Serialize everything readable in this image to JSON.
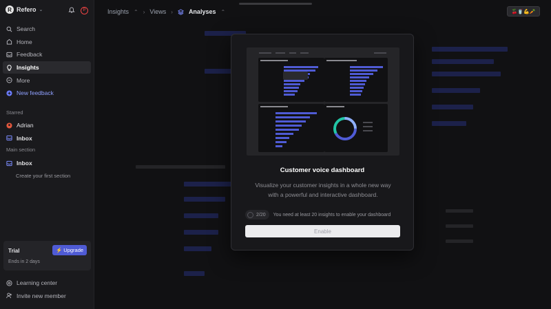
{
  "sidebar": {
    "workspace": {
      "logo": "R",
      "name": "Refero"
    },
    "nav": [
      {
        "label": "Search",
        "icon": "search-icon"
      },
      {
        "label": "Home",
        "icon": "home-icon"
      },
      {
        "label": "Feedback",
        "icon": "inbox-icon"
      },
      {
        "label": "Insights",
        "icon": "lightbulb-icon",
        "active": true
      },
      {
        "label": "More",
        "icon": "more-icon"
      },
      {
        "label": "New feedback",
        "icon": "plus-circle-icon"
      }
    ],
    "starred_label": "Starred",
    "starred": [
      {
        "label": "Adrian",
        "icon": "user-avatar-icon"
      },
      {
        "label": "Inbox",
        "icon": "inbox-icon"
      }
    ],
    "main_section_label": "Main section",
    "main_section": [
      {
        "label": "Inbox",
        "icon": "inbox-icon"
      }
    ],
    "create_section": "Create your first section",
    "trial": {
      "title": "Trial",
      "upgrade_label": "Upgrade",
      "ends": "Ends in 2 days"
    },
    "footer": [
      {
        "label": "Learning center",
        "icon": "learning-center-icon"
      },
      {
        "label": "Invite new member",
        "icon": "user-plus-icon"
      }
    ]
  },
  "breadcrumbs": [
    "Insights",
    "Views",
    "Analyses"
  ],
  "emoji_box": "🍒🥤💪🥕",
  "modal": {
    "title": "Customer voice dashboard",
    "description": "Visualize your customer insights in a whole new way with a powerful and interactive dashboard.",
    "progress": {
      "current": 2,
      "total": 20,
      "label": "2/20"
    },
    "requirement": "You need at least 20 insights to enable your dashboard",
    "enable_label": "Enable"
  },
  "colors": {
    "accent": "#4f5bd5",
    "sidebar_bg": "#1a1a1d",
    "page_bg": "#111113"
  }
}
